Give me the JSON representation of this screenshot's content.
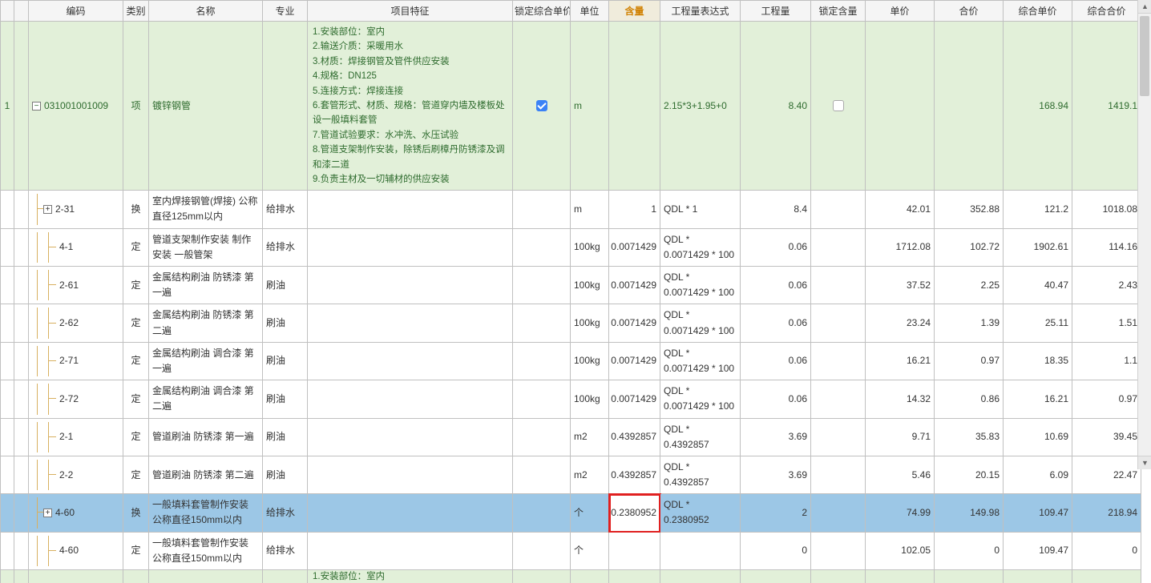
{
  "headers": {
    "c0": "",
    "c1": "",
    "code": "编码",
    "category": "类别",
    "name": "名称",
    "major": "专业",
    "feature": "项目特征",
    "lock_unit_price": "锁定综合单价",
    "unit": "单位",
    "content": "含量",
    "qty_expr": "工程量表达式",
    "qty": "工程量",
    "lock_content": "锁定含量",
    "unit_price": "单价",
    "total_price": "合价",
    "comp_unit_price": "综合单价",
    "comp_total_price": "综合合价"
  },
  "rows": [
    {
      "idx": "1",
      "tree": "minus",
      "code": "031001001009",
      "category": "项",
      "name": "镀锌钢管",
      "major": "",
      "feature": "1.安装部位：室内\n2.输送介质：采暖用水\n3.材质：焊接钢管及管件供应安装\n4.规格：DN125\n5.连接方式：焊接连接\n6.套管形式、材质、规格：管道穿内墙及楼板处设一般填料套管\n7.管道试验要求：水冲洗、水压试验\n8.管道支架制作安装，除锈后刷樟丹防锈漆及调和漆二道\n9.负责主材及一切辅材的供应安装",
      "lock_unit_price": "checked",
      "unit": "m",
      "content": "",
      "qty_expr": "2.15*3+1.95+0",
      "qty": "8.40",
      "lock_content": "empty",
      "unit_price": "",
      "total_price": "",
      "comp_unit_price": "168.94",
      "comp_total_price": "1419.1",
      "cls": "row-green"
    },
    {
      "idx": "",
      "tree": "plus-child",
      "code": "2-31",
      "category": "换",
      "name": "室内焊接钢管(焊接) 公称直径125mm以内",
      "major": "给排水",
      "feature": "",
      "lock_unit_price": "",
      "unit": "m",
      "content": "1",
      "qty_expr": "QDL * 1",
      "qty": "8.4",
      "lock_content": "",
      "unit_price": "42.01",
      "total_price": "352.88",
      "comp_unit_price": "121.2",
      "comp_total_price": "1018.08",
      "cls": "row-white"
    },
    {
      "idx": "",
      "tree": "leaf",
      "code": "4-1",
      "category": "定",
      "name": "管道支架制作安装 制作安装 一般管架",
      "major": "给排水",
      "feature": "",
      "lock_unit_price": "",
      "unit": "100kg",
      "content": "0.0071429",
      "qty_expr": "QDL * 0.0071429 * 100",
      "qty": "0.06",
      "lock_content": "",
      "unit_price": "1712.08",
      "total_price": "102.72",
      "comp_unit_price": "1902.61",
      "comp_total_price": "114.16",
      "cls": "row-white"
    },
    {
      "idx": "",
      "tree": "leaf",
      "code": "2-61",
      "category": "定",
      "name": "金属结构刷油 防锈漆 第一遍",
      "major": "刷油",
      "feature": "",
      "lock_unit_price": "",
      "unit": "100kg",
      "content": "0.0071429",
      "qty_expr": "QDL * 0.0071429 * 100",
      "qty": "0.06",
      "lock_content": "",
      "unit_price": "37.52",
      "total_price": "2.25",
      "comp_unit_price": "40.47",
      "comp_total_price": "2.43",
      "cls": "row-white"
    },
    {
      "idx": "",
      "tree": "leaf",
      "code": "2-62",
      "category": "定",
      "name": "金属结构刷油 防锈漆 第二遍",
      "major": "刷油",
      "feature": "",
      "lock_unit_price": "",
      "unit": "100kg",
      "content": "0.0071429",
      "qty_expr": "QDL * 0.0071429 * 100",
      "qty": "0.06",
      "lock_content": "",
      "unit_price": "23.24",
      "total_price": "1.39",
      "comp_unit_price": "25.11",
      "comp_total_price": "1.51",
      "cls": "row-white"
    },
    {
      "idx": "",
      "tree": "leaf",
      "code": "2-71",
      "category": "定",
      "name": "金属结构刷油 调合漆 第一遍",
      "major": "刷油",
      "feature": "",
      "lock_unit_price": "",
      "unit": "100kg",
      "content": "0.0071429",
      "qty_expr": "QDL * 0.0071429 * 100",
      "qty": "0.06",
      "lock_content": "",
      "unit_price": "16.21",
      "total_price": "0.97",
      "comp_unit_price": "18.35",
      "comp_total_price": "1.1",
      "cls": "row-white"
    },
    {
      "idx": "",
      "tree": "leaf",
      "code": "2-72",
      "category": "定",
      "name": "金属结构刷油 调合漆 第二遍",
      "major": "刷油",
      "feature": "",
      "lock_unit_price": "",
      "unit": "100kg",
      "content": "0.0071429",
      "qty_expr": "QDL * 0.0071429 * 100",
      "qty": "0.06",
      "lock_content": "",
      "unit_price": "14.32",
      "total_price": "0.86",
      "comp_unit_price": "16.21",
      "comp_total_price": "0.97",
      "cls": "row-white"
    },
    {
      "idx": "",
      "tree": "leaf",
      "code": "2-1",
      "category": "定",
      "name": "管道刷油 防锈漆 第一遍",
      "major": "刷油",
      "feature": "",
      "lock_unit_price": "",
      "unit": "m2",
      "content": "0.4392857",
      "qty_expr": "QDL * 0.4392857",
      "qty": "3.69",
      "lock_content": "",
      "unit_price": "9.71",
      "total_price": "35.83",
      "comp_unit_price": "10.69",
      "comp_total_price": "39.45",
      "cls": "row-white"
    },
    {
      "idx": "",
      "tree": "leaf",
      "code": "2-2",
      "category": "定",
      "name": "管道刷油 防锈漆 第二遍",
      "major": "刷油",
      "feature": "",
      "lock_unit_price": "",
      "unit": "m2",
      "content": "0.4392857",
      "qty_expr": "QDL * 0.4392857",
      "qty": "3.69",
      "lock_content": "",
      "unit_price": "5.46",
      "total_price": "20.15",
      "comp_unit_price": "6.09",
      "comp_total_price": "22.47",
      "cls": "row-white"
    },
    {
      "idx": "",
      "tree": "plus-child",
      "code": "4-60",
      "category": "换",
      "name": "一般填料套管制作安装 公称直径150mm以内",
      "major": "给排水",
      "feature": "",
      "lock_unit_price": "",
      "unit": "个",
      "content": "0.2380952",
      "qty_expr": "QDL * 0.2380952",
      "qty": "2",
      "lock_content": "",
      "unit_price": "74.99",
      "total_price": "149.98",
      "comp_unit_price": "109.47",
      "comp_total_price": "218.94",
      "cls": "row-blue",
      "highlight_content": true
    },
    {
      "idx": "",
      "tree": "leaf",
      "code": "4-60",
      "category": "定",
      "name": "一般填料套管制作安装 公称直径150mm以内",
      "major": "给排水",
      "feature": "",
      "lock_unit_price": "",
      "unit": "个",
      "content": "",
      "qty_expr": "",
      "qty": "0",
      "lock_content": "",
      "unit_price": "102.05",
      "total_price": "0",
      "comp_unit_price": "109.47",
      "comp_total_price": "0",
      "cls": "row-white"
    }
  ],
  "partial_next": "1.安装部位：室内"
}
